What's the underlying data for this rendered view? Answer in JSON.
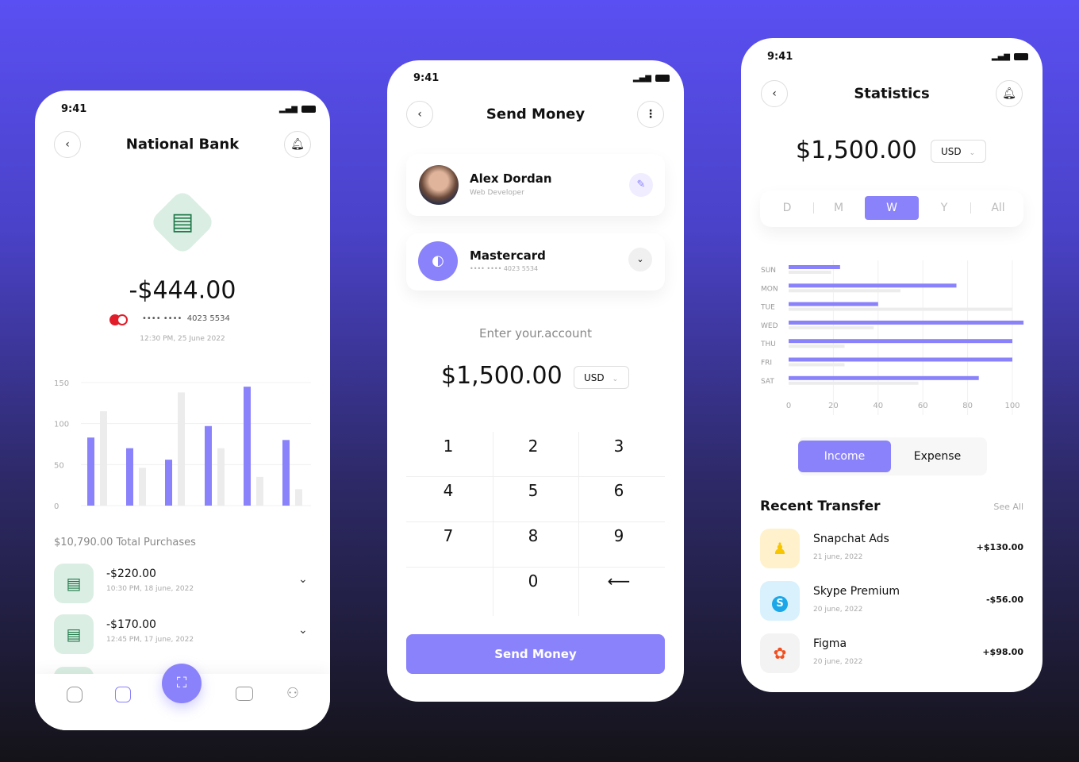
{
  "colors": {
    "accent": "#8a82fb",
    "bank_green": "#1f7a4a",
    "bank_bg": "#dbeee3"
  },
  "phone1": {
    "time": "9:41",
    "title": "National Bank",
    "amount": "-$444.00",
    "card_masked": "•••• ••••",
    "card_last": "4023   5534",
    "datetime": "12:30 PM, 25 June 2022",
    "total_label": "$10,790.00 Total Purchases",
    "transactions": [
      {
        "amount": "-$220.00",
        "date": "10:30 PM, 18 june, 2022"
      },
      {
        "amount": "-$170.00",
        "date": "12:45 PM, 17 june, 2022"
      }
    ],
    "nav": [
      "home-icon",
      "activity-icon",
      "scan-icon",
      "wallet-icon",
      "profile-icon"
    ]
  },
  "phone2": {
    "time": "9:41",
    "title": "Send Money",
    "contact": {
      "name": "Alex Dordan",
      "role": "Web Developer"
    },
    "card": {
      "name": "Mastercard",
      "number": "•••• ••••  4023  5534"
    },
    "prompt": "Enter your.account",
    "amount": "$1,500.00",
    "currency": "USD",
    "keys": [
      "1",
      "2",
      "3",
      "4",
      "5",
      "6",
      "7",
      "8",
      "9",
      "",
      "0",
      "⟵"
    ],
    "send_label": "Send Money"
  },
  "phone3": {
    "time": "9:41",
    "title": "Statistics",
    "amount": "$1,500.00",
    "currency": "USD",
    "periods": [
      "D",
      "M",
      "W",
      "Y",
      "All"
    ],
    "active_period": "W",
    "toggle": [
      "Income",
      "Expense"
    ],
    "active_toggle": "Income",
    "recent_title": "Recent Transfer",
    "see_all": "See All",
    "transfers": [
      {
        "name": "Snapchat Ads",
        "date": "21 june, 2022",
        "amount": "+$130.00",
        "icon": "snapchat-icon",
        "bg": "#fff1cc"
      },
      {
        "name": "Skype Premium",
        "date": "20 june, 2022",
        "amount": "-$56.00",
        "icon": "skype-icon",
        "bg": "#d9f1fc"
      },
      {
        "name": "Figma",
        "date": "20 june, 2022",
        "amount": "+$98.00",
        "icon": "figma-icon",
        "bg": "#f3f3f3"
      }
    ]
  },
  "chart_data": [
    {
      "type": "bar",
      "yticks": [
        "0",
        "50",
        "100",
        "150"
      ],
      "ylim": [
        0,
        150
      ],
      "grid": true,
      "series": [
        {
          "values": [
            83,
            70,
            56,
            97,
            145,
            80
          ],
          "color": "#8a82fb"
        },
        {
          "values": [
            115,
            46,
            138,
            70,
            35,
            20
          ],
          "color": "#ececec"
        }
      ]
    },
    {
      "type": "bar",
      "orientation": "horizontal",
      "categories": [
        "SUN",
        "MON",
        "TUE",
        "WED",
        "THU",
        "FRI",
        "SAT"
      ],
      "xticks": [
        "0",
        "20",
        "40",
        "60",
        "80",
        "100"
      ],
      "xlim": [
        0,
        100
      ],
      "grid": true,
      "series": [
        {
          "values": [
            23,
            75,
            40,
            105,
            100,
            100,
            85
          ],
          "color": "#8a82fb"
        },
        {
          "values": [
            19,
            50,
            100,
            38,
            25,
            25,
            58
          ],
          "color": "#ececec"
        }
      ]
    }
  ]
}
